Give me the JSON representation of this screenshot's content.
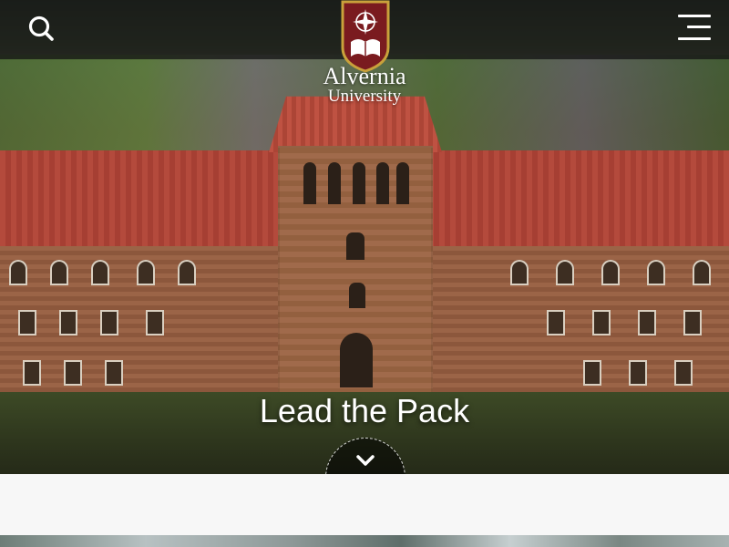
{
  "header": {
    "search_icon": "search-icon",
    "menu_icon": "hamburger-menu-icon",
    "logo": {
      "name": "Alvernia",
      "sub": "University",
      "icon": "crest-icon",
      "colors": {
        "shield": "#7a1b1f",
        "accent": "#c9a13b"
      }
    }
  },
  "hero": {
    "headline": "Lead the Pack",
    "scroll_icon": "chevron-down-icon"
  },
  "colors": {
    "topbar": "#141414",
    "band": "#f7f7f7",
    "text": "#ffffff"
  }
}
